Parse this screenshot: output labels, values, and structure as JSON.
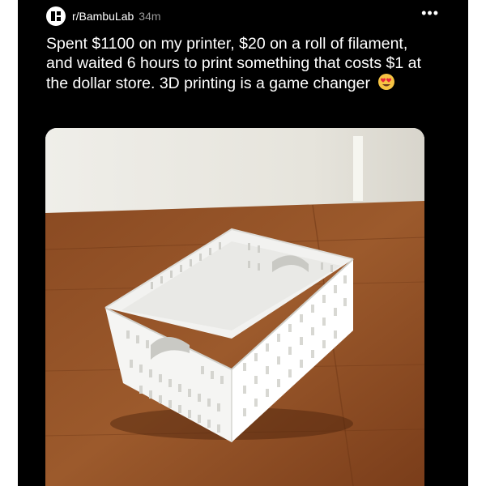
{
  "post": {
    "subreddit": "r/BambuLab",
    "age": "34m",
    "more_label": "•••",
    "text": "Spent $1100 on my printer, $20 on a roll of filament, and waited 6 hours to print something that costs $1 at the dollar store. 3D printing is a game changer",
    "emoji": "heart-eyes-emoji",
    "image": "photo-white-storage-basket-on-wooden-table"
  },
  "colors": {
    "background": "#000000",
    "text": "#ffffff",
    "muted": "#9a9a9a"
  }
}
